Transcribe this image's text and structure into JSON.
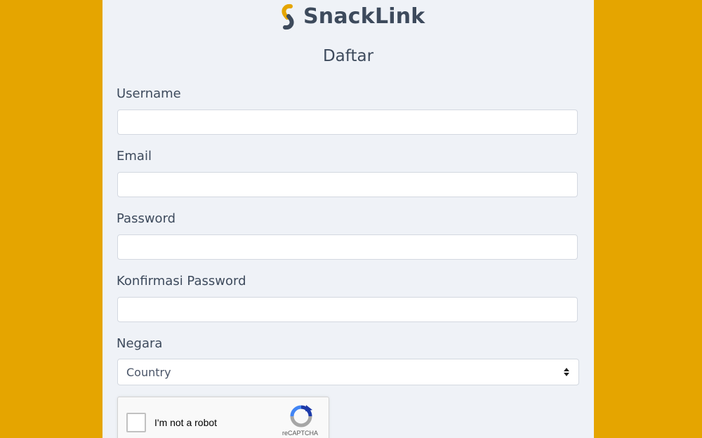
{
  "brand": {
    "name": "SnackLink",
    "logo_icon": "chain-link-icon",
    "colors": {
      "background": "#e5a500",
      "panel": "#eff2f7",
      "text": "#3d4a5c"
    }
  },
  "form": {
    "title": "Daftar",
    "fields": [
      {
        "label": "Username",
        "value": ""
      },
      {
        "label": "Email",
        "value": ""
      },
      {
        "label": "Password",
        "value": ""
      },
      {
        "label": "Konfirmasi Password",
        "value": ""
      }
    ],
    "country": {
      "label": "Negara",
      "selected": "Country"
    },
    "captcha": {
      "label": "I'm not a robot",
      "brand": "reCAPTCHA",
      "checked": false
    }
  }
}
